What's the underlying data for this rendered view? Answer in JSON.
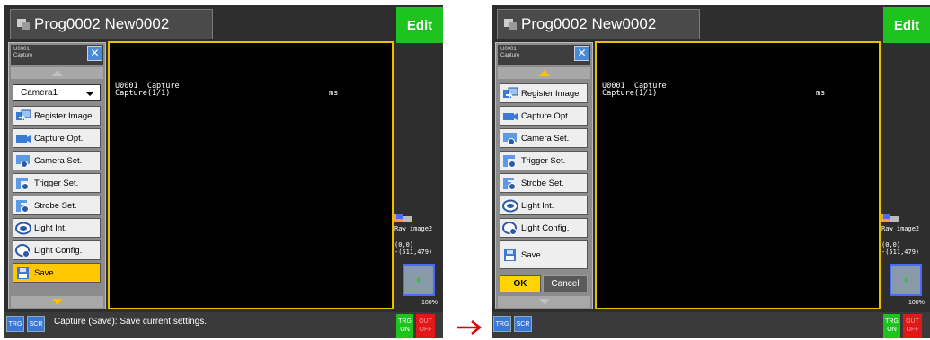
{
  "screens": [
    {
      "title": "Prog0002 New0002",
      "edit_label": "Edit",
      "menu_header": {
        "line1": "U0001",
        "line2": "Capture"
      },
      "camera_select": "Camera1",
      "menu_items": [
        {
          "label": "Register Image",
          "icon": "register-image-icon"
        },
        {
          "label": "Capture Opt.",
          "icon": "camera-icon"
        },
        {
          "label": "Camera Set.",
          "icon": "camera-settings-icon"
        },
        {
          "label": "Trigger Set.",
          "icon": "trigger-icon"
        },
        {
          "label": "Strobe Set.",
          "icon": "strobe-icon"
        },
        {
          "label": "Light Int.",
          "icon": "light-icon"
        },
        {
          "label": "Light Config.",
          "icon": "light-config-icon"
        },
        {
          "label": "Save",
          "icon": "save-icon"
        }
      ],
      "selected_item": "Save",
      "display_lines": {
        "unit": "U0001  Capture",
        "sub": "Capture(1/1)",
        "unit_label": "ms"
      },
      "raw_label": "Raw image2",
      "coord_line1": "(0,0)",
      "coord_line2": "-(511,479)",
      "zoom": "100%",
      "trg_label": "TRG",
      "scr_label": "SCR",
      "status_text": "Capture (Save): Save current settings.",
      "trg_on": {
        "line1": "TRG",
        "line2": "ON"
      },
      "out_off": {
        "line1": "OUT",
        "line2": "OFF"
      }
    },
    {
      "title": "Prog0002 New0002",
      "edit_label": "Edit",
      "menu_header": {
        "line1": "U0001",
        "line2": "Capture"
      },
      "menu_items": [
        {
          "label": "Register Image",
          "icon": "register-image-icon"
        },
        {
          "label": "Capture Opt.",
          "icon": "camera-icon"
        },
        {
          "label": "Camera Set.",
          "icon": "camera-settings-icon"
        },
        {
          "label": "Trigger Set.",
          "icon": "trigger-icon"
        },
        {
          "label": "Strobe Set.",
          "icon": "strobe-icon"
        },
        {
          "label": "Light Int.",
          "icon": "light-icon"
        },
        {
          "label": "Light Config.",
          "icon": "light-config-icon"
        },
        {
          "label": "Save",
          "icon": "save-icon"
        }
      ],
      "ok_label": "OK",
      "cancel_label": "Cancel",
      "display_lines": {
        "unit": "U0001  Capture",
        "sub": "Capture(1/1)",
        "unit_label": "ms"
      },
      "raw_label": "Raw image2",
      "coord_line1": "(0,0)",
      "coord_line2": "-(511,479)",
      "zoom": "100%",
      "trg_label": "TRG",
      "scr_label": "SCR",
      "trg_on": {
        "line1": "TRG",
        "line2": "ON"
      },
      "out_off": {
        "line1": "OUT",
        "line2": "OFF"
      }
    }
  ],
  "colors": {
    "accent_yellow": "#ffc800",
    "edit_green": "#1ec41e",
    "out_red": "#e01818",
    "arrow_red": "#e00000"
  }
}
